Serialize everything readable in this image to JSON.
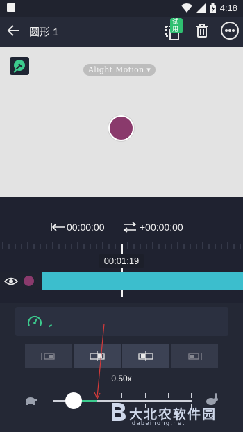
{
  "status_bar": {
    "time": "4:18"
  },
  "top_bar": {
    "title": "圆形 1",
    "trial_badge": "试用"
  },
  "canvas": {
    "watermark": "Alight Motion ▾",
    "shape_color": "#8a3a6c",
    "background_color": "#e3e3e3"
  },
  "timeline": {
    "start_time": "00:00:00",
    "offset_time": "+00:00:00",
    "playhead_time": "00:01:19",
    "track_color": "#3cbecd"
  },
  "speed_panel": {
    "accent_color": "#3ccb8e",
    "speed_value": "0.50x",
    "slider_fraction": 0.15,
    "segments": [
      {
        "id": "ease-in",
        "active": false
      },
      {
        "id": "center-left",
        "active": true
      },
      {
        "id": "center-right",
        "active": true
      },
      {
        "id": "ease-out",
        "active": false
      }
    ]
  },
  "watermark_logo": {
    "text": "大北农软件园",
    "sub": "dabeinong.net"
  },
  "icons": [
    "back-arrow-icon",
    "duplicate-icon",
    "trash-icon",
    "more-icon",
    "eyedropper-icon",
    "eye-icon",
    "speedometer-icon",
    "turtle-icon",
    "rabbit-icon"
  ]
}
